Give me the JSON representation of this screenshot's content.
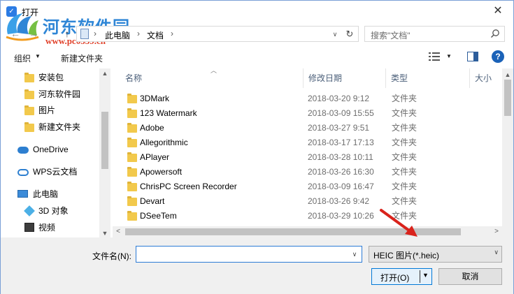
{
  "window": {
    "title": "打开",
    "close_glyph": "✕"
  },
  "watermark": {
    "name": "河东软件园",
    "url": "www.pc0359.cn"
  },
  "nav": {
    "back_glyph": "←",
    "forward_glyph": "→",
    "up_glyph": "↑",
    "breadcrumbs": [
      "此电脑",
      "文档"
    ],
    "separator": "›",
    "dropdown_glyph": "∨",
    "refresh_glyph": "↻",
    "search_placeholder": "搜索\"文档\""
  },
  "toolbar": {
    "organize": "组织",
    "caret": "▼",
    "new_folder": "新建文件夹",
    "help": "?"
  },
  "sidebar": {
    "items": [
      {
        "label": "安装包",
        "icon": "folder-icon"
      },
      {
        "label": "河东软件园",
        "icon": "folder-icon"
      },
      {
        "label": "图片",
        "icon": "folder-icon"
      },
      {
        "label": "新建文件夹",
        "icon": "folder-icon"
      },
      {
        "label": "OneDrive",
        "icon": "cloud-icon"
      },
      {
        "label": "WPS云文档",
        "icon": "cloud-icon"
      },
      {
        "label": "此电脑",
        "icon": "computer-icon"
      },
      {
        "label": "3D 对象",
        "icon": "cube-icon"
      },
      {
        "label": "视频",
        "icon": "video-icon"
      }
    ]
  },
  "filelist": {
    "columns": [
      "名称",
      "修改日期",
      "类型",
      "大小"
    ],
    "rows": [
      {
        "name": "3DMark",
        "date": "2018-03-20 9:12",
        "type": "文件夹"
      },
      {
        "name": "123 Watermark",
        "date": "2018-03-09 15:55",
        "type": "文件夹"
      },
      {
        "name": "Adobe",
        "date": "2018-03-27 9:51",
        "type": "文件夹"
      },
      {
        "name": "Allegorithmic",
        "date": "2018-03-17 17:13",
        "type": "文件夹"
      },
      {
        "name": "APlayer",
        "date": "2018-03-28 10:11",
        "type": "文件夹"
      },
      {
        "name": "Apowersoft",
        "date": "2018-03-26 16:30",
        "type": "文件夹"
      },
      {
        "name": "ChrisPC Screen Recorder",
        "date": "2018-03-09 16:47",
        "type": "文件夹"
      },
      {
        "name": "Devart",
        "date": "2018-03-26 9:42",
        "type": "文件夹"
      },
      {
        "name": "DSeeTem",
        "date": "2018-03-29 10:26",
        "type": "文件夹"
      }
    ]
  },
  "bottom": {
    "filename_label": "文件名(N):",
    "filename_value": "",
    "filter": "HEIC 图片(*.heic)",
    "open": "打开(O)",
    "cancel": "取消"
  },
  "colors": {
    "accent": "#0078d7",
    "watermark_blue": "#2f86d6",
    "watermark_red": "#e0412a",
    "annotation_arrow": "#d9231c",
    "folder": "#f2c94c"
  }
}
